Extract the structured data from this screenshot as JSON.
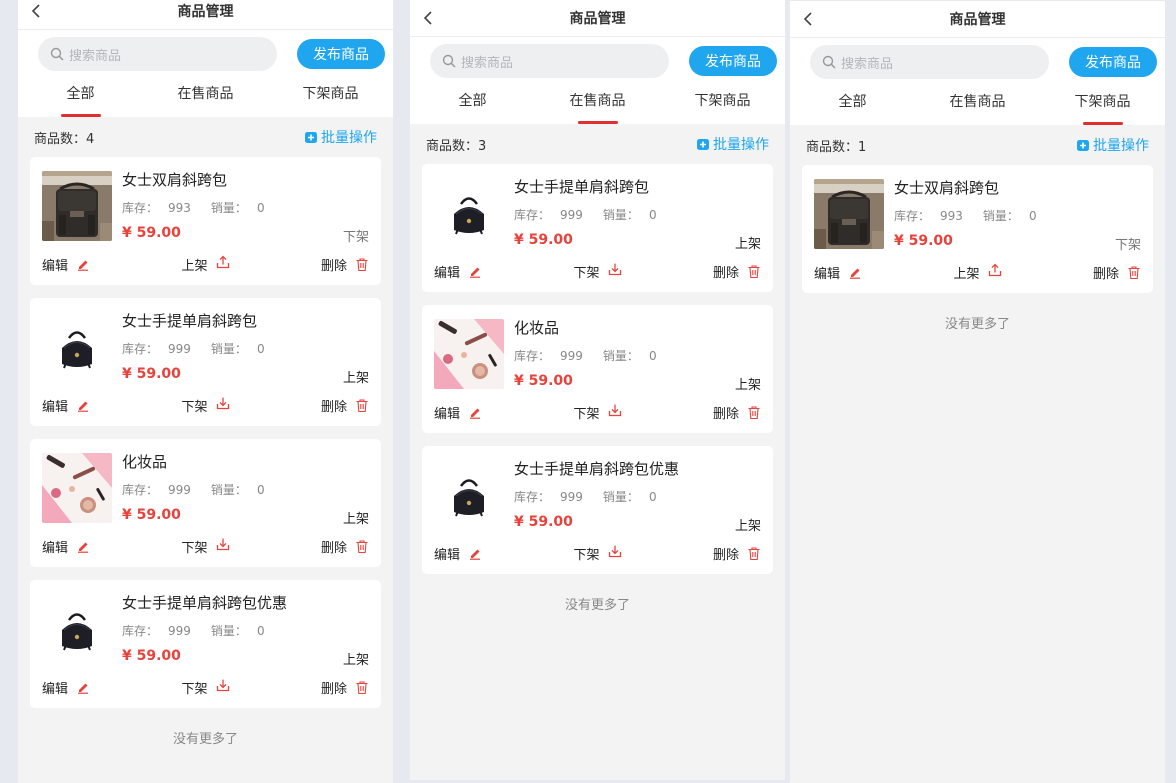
{
  "common": {
    "title": "商品管理",
    "search_placeholder": "搜索商品",
    "publish_label": "发布商品",
    "tabs": [
      "全部",
      "在售商品",
      "下架商品"
    ],
    "count_prefix": "商品数：",
    "batch_label": "批量操作",
    "stock_prefix": "库存：",
    "sales_prefix": "销量：",
    "edit_label": "编辑",
    "delete_label": "删除",
    "no_more": "没有更多了"
  },
  "colors": {
    "accent": "#1fa6ee",
    "price": "#e8423c",
    "tab_indicator": "#e02f2f"
  },
  "panels": [
    {
      "active_tab": 0,
      "count": "4",
      "items": [
        {
          "name": "女士双肩斜跨包",
          "stock": "993",
          "sales": "0",
          "price": "¥ 59.00",
          "status": "下架",
          "toggle_label": "上架",
          "toggle_icon": "upload-icon",
          "image": "backpack-brown"
        },
        {
          "name": "女士手提单肩斜跨包",
          "stock": "999",
          "sales": "0",
          "price": "¥ 59.00",
          "status": "上架",
          "toggle_label": "下架",
          "toggle_icon": "download-icon",
          "image": "backpack-black"
        },
        {
          "name": "化妆品",
          "stock": "999",
          "sales": "0",
          "price": "¥ 59.00",
          "status": "上架",
          "toggle_label": "下架",
          "toggle_icon": "download-icon",
          "image": "cosmetics"
        },
        {
          "name": "女士手提单肩斜跨包优惠",
          "stock": "999",
          "sales": "0",
          "price": "¥ 59.00",
          "status": "上架",
          "toggle_label": "下架",
          "toggle_icon": "download-icon",
          "image": "backpack-black"
        }
      ]
    },
    {
      "active_tab": 1,
      "count": "3",
      "items": [
        {
          "name": "女士手提单肩斜跨包",
          "stock": "999",
          "sales": "0",
          "price": "¥ 59.00",
          "status": "上架",
          "toggle_label": "下架",
          "toggle_icon": "download-icon",
          "image": "backpack-black"
        },
        {
          "name": "化妆品",
          "stock": "999",
          "sales": "0",
          "price": "¥ 59.00",
          "status": "上架",
          "toggle_label": "下架",
          "toggle_icon": "download-icon",
          "image": "cosmetics"
        },
        {
          "name": "女士手提单肩斜跨包优惠",
          "stock": "999",
          "sales": "0",
          "price": "¥ 59.00",
          "status": "上架",
          "toggle_label": "下架",
          "toggle_icon": "download-icon",
          "image": "backpack-black"
        }
      ]
    },
    {
      "active_tab": 2,
      "count": "1",
      "items": [
        {
          "name": "女士双肩斜跨包",
          "stock": "993",
          "sales": "0",
          "price": "¥ 59.00",
          "status": "下架",
          "toggle_label": "上架",
          "toggle_icon": "upload-icon",
          "image": "backpack-brown"
        }
      ]
    }
  ]
}
